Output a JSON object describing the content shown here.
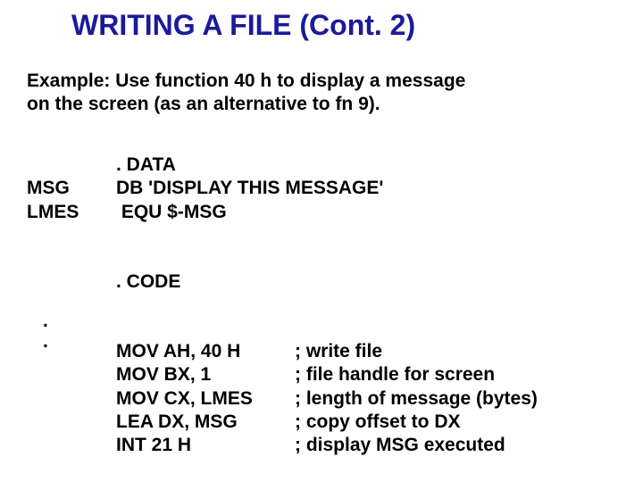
{
  "title": "WRITING A FILE (Cont. 2)",
  "example_line1": "Example: Use function 40 h to display a message",
  "example_line2": "on the screen (as an alternative to fn 9).",
  "data_section": {
    "directive": ". DATA",
    "msg_label": "MSG",
    "msg_def": "DB 'DISPLAY THIS MESSAGE'",
    "lmes_label": "LMES",
    "lmes_def": " EQU $-MSG"
  },
  "code_section": {
    "directive": ". CODE",
    "dots": ".\n.",
    "lines": [
      {
        "instr": "MOV AH, 40 H",
        "comment": "; write file"
      },
      {
        "instr": "MOV BX, 1",
        "comment": "; file handle for screen"
      },
      {
        "instr": "MOV CX, LMES",
        "comment": "; length of message (bytes)"
      },
      {
        "instr": "LEA DX, MSG",
        "comment": "; copy offset to DX"
      },
      {
        "instr": "INT 21 H",
        "comment": "; display MSG executed"
      }
    ]
  }
}
